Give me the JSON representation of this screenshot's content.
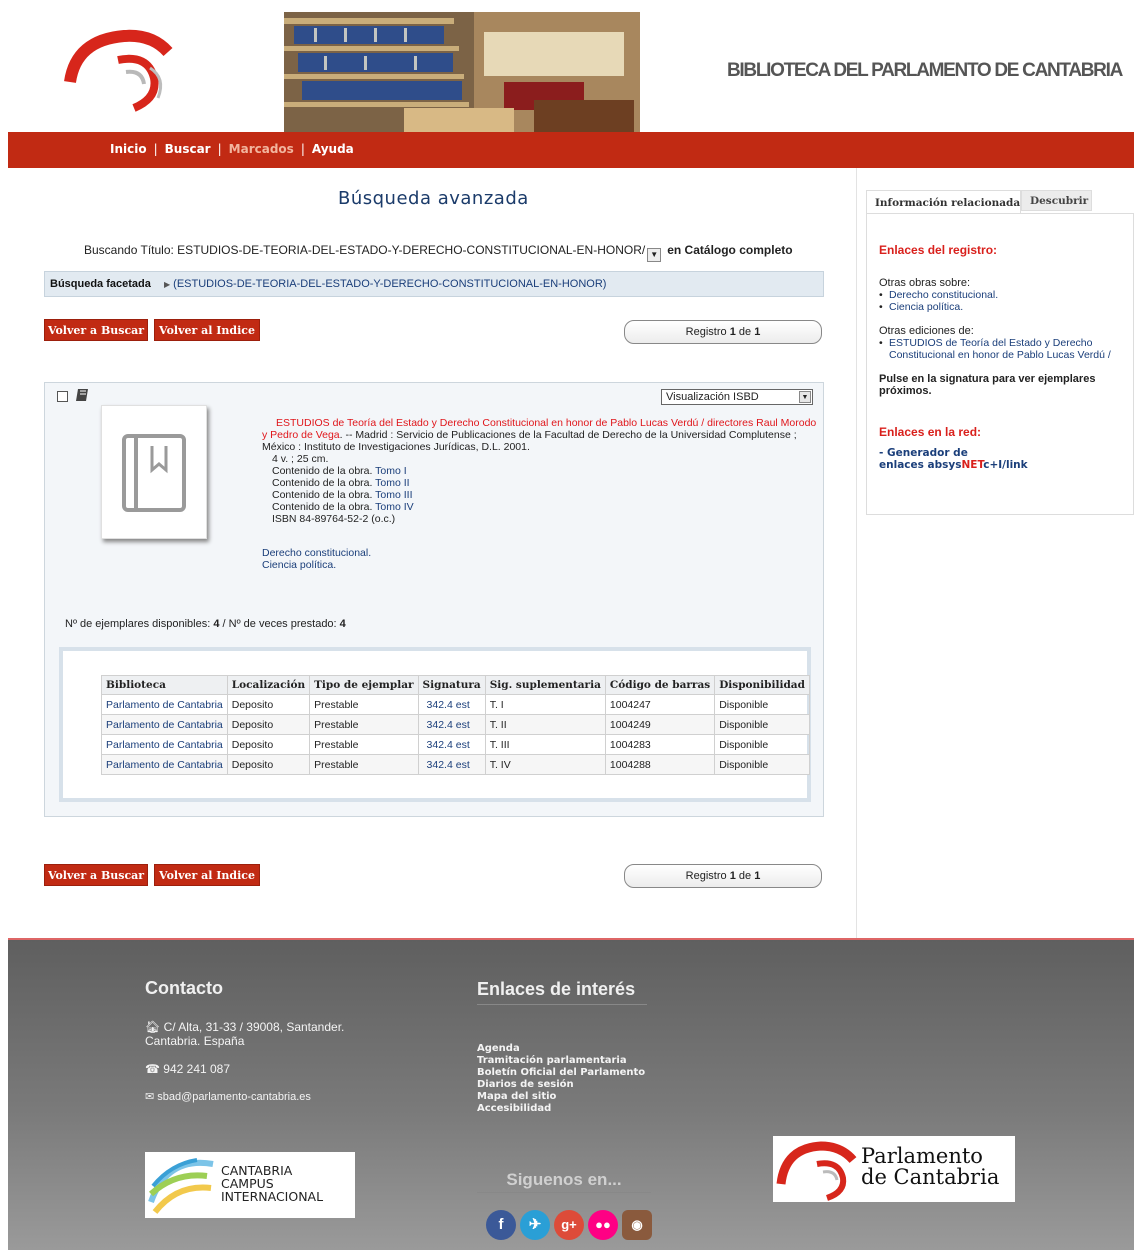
{
  "header": {
    "site_title": "BIBLIOTECA DEL PARLAMENTO DE CANTABRIA"
  },
  "nav": {
    "items": [
      "Inicio",
      "Buscar",
      "Marcados",
      "Ayuda"
    ],
    "active": "Marcados"
  },
  "main": {
    "page_title": "Búsqueda avanzada",
    "search": {
      "prefix": "Buscando",
      "field_value": "Título: ESTUDIOS-DE-TEORIA-DEL-ESTADO-Y-DERECHO-CONSTITUCIONAL-EN-HONOR/",
      "suffix": "en Catálogo completo"
    },
    "facet": {
      "label": "Búsqueda facetada",
      "link": "(ESTUDIOS-DE-TEORIA-DEL-ESTADO-Y-DERECHO-CONSTITUCIONAL-EN-HONOR)"
    },
    "buttons": {
      "back_search": "Volver a Buscar",
      "back_index": "Volver al Indice"
    },
    "record_counter": {
      "prefix": "Registro",
      "current": "1",
      "of": "de",
      "total": "1"
    },
    "record": {
      "view_select": "Visualización ISBD",
      "title_red": "ESTUDIOS de Teoría del Estado y Derecho Constitucional en honor de Pablo Lucas Verdú / directores Raul Morodo y Pedro de Vega",
      "publication": ". -- Madrid : Servicio de Publicaciones de la Facultad de Derecho de la Universidad Complutense ; México : Instituto de Investigaciones Jurídicas, D.L. 2001.",
      "physical": "4 v. ; 25 cm.",
      "contents": [
        {
          "label": "Contenido de la obra.",
          "link": "Tomo I"
        },
        {
          "label": "Contenido de la obra.",
          "link": "Tomo II"
        },
        {
          "label": "Contenido de la obra.",
          "link": "Tomo III"
        },
        {
          "label": "Contenido de la obra.",
          "link": "Tomo IV"
        }
      ],
      "isbn": "ISBN 84-89764-52-2 (o.c.)",
      "subjects": [
        "Derecho constitucional.",
        "Ciencia política."
      ],
      "copies_line": {
        "available_label": "Nº de ejemplares disponibles:",
        "available": "4",
        "sep": "/",
        "loaned_label": "Nº de veces prestado:",
        "loaned": "4"
      }
    },
    "copies_table": {
      "headers": [
        "Biblioteca",
        "Localización",
        "Tipo de ejemplar",
        "Signatura",
        "Sig. suplementaria",
        "Código de barras",
        "Disponibilidad"
      ],
      "rows": [
        [
          "Parlamento de Cantabria",
          "Deposito",
          "Prestable",
          "342.4 est",
          "T. I",
          "1004247",
          "Disponible"
        ],
        [
          "Parlamento de Cantabria",
          "Deposito",
          "Prestable",
          "342.4 est",
          "T. II",
          "1004249",
          "Disponible"
        ],
        [
          "Parlamento de Cantabria",
          "Deposito",
          "Prestable",
          "342.4 est",
          "T. III",
          "1004283",
          "Disponible"
        ],
        [
          "Parlamento de Cantabria",
          "Deposito",
          "Prestable",
          "342.4 est",
          "T. IV",
          "1004288",
          "Disponible"
        ]
      ]
    }
  },
  "sidebar": {
    "tabs": [
      "Información relacionada",
      "Descubrir"
    ],
    "record_links_heading": "Enlaces del registro:",
    "other_works_label": "Otras obras sobre:",
    "other_works": [
      "Derecho constitucional.",
      "Ciencia política."
    ],
    "other_editions_label": "Otras ediciones de:",
    "other_editions": [
      "ESTUDIOS de Teoría del Estado y Derecho Constitucional en honor de Pablo Lucas Verdú /"
    ],
    "hint": "Pulse en la signatura para ver ejemplares próximos.",
    "web_links_heading": "Enlaces en la red:",
    "generator": {
      "prefix": "- Generador de",
      "line2_a": "enlaces absys",
      "net": "NET",
      "line2_b": "c+I/link"
    }
  },
  "footer": {
    "contact_heading": "Contacto",
    "address": "C/ Alta, 31-33 / 39008, Santander. Cantabria. España",
    "phone": "942 241 087",
    "email": "sbad@parlamento-cantabria.es",
    "links_heading": "Enlaces de interés",
    "links": [
      "Agenda",
      "Tramitación parlamentaria",
      "Boletín Oficial del Parlamento",
      "Diarios de sesión",
      "Mapa del sitio",
      "Accesibilidad"
    ],
    "follow": "Siguenos en...",
    "campus_logo_lines": [
      "CANTABRIA",
      "CAMPUS",
      "INTERNACIONAL"
    ],
    "parl_logo_lines": [
      "Parlamento",
      "de Cantabria"
    ],
    "social": [
      "facebook-icon",
      "twitter-icon",
      "google-plus-icon",
      "flickr-icon",
      "instagram-icon"
    ],
    "colors": {
      "nav": "#c12a13",
      "accent_red": "#d9201c",
      "link": "#1a3e7a"
    }
  }
}
